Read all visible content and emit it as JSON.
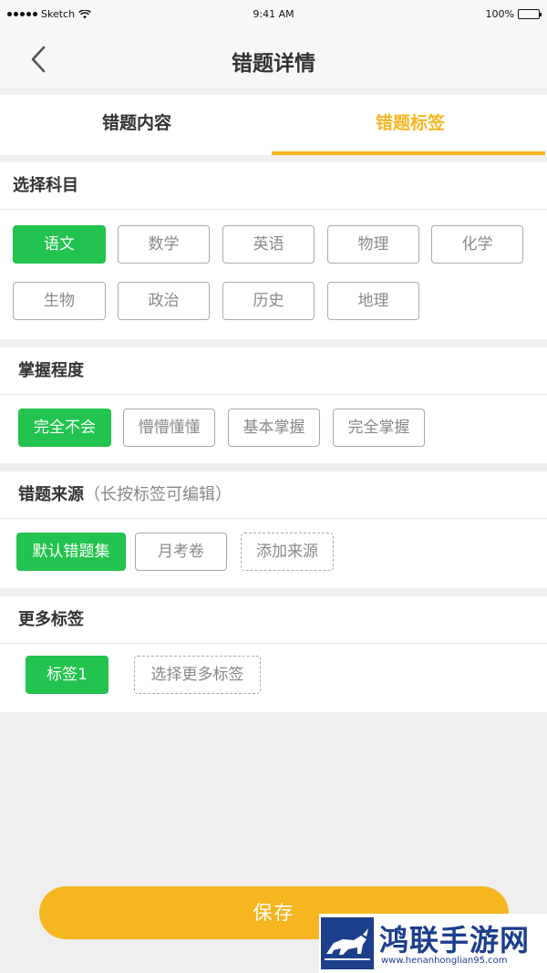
{
  "status_bar": {
    "carrier": "Sketch",
    "time": "9:41 AM",
    "battery": "100%"
  },
  "nav": {
    "title": "错题详情"
  },
  "tabs": [
    {
      "label": "错题内容",
      "active": false
    },
    {
      "label": "错题标签",
      "active": true
    }
  ],
  "subject_section": {
    "title": "选择科目",
    "options": [
      "语文",
      "数学",
      "英语",
      "物理",
      "化学",
      "生物",
      "政治",
      "历史",
      "地理"
    ],
    "selected": "语文"
  },
  "mastery_section": {
    "title": "掌握程度",
    "options": [
      "完全不会",
      "懵懵懂懂",
      "基本掌握",
      "完全掌握"
    ],
    "selected": "完全不会"
  },
  "source_section": {
    "title": "错题来源",
    "hint": "（长按标签可编辑）",
    "options": [
      "默认错题集",
      "月考卷"
    ],
    "selected": "默认错题集",
    "add_label": "添加来源"
  },
  "tags_section": {
    "title": "更多标签",
    "options": [
      "标签1"
    ],
    "selected": "标签1",
    "more_label": "选择更多标签"
  },
  "save_label": "保存",
  "watermark": {
    "name": "鸿联手游网",
    "url": "www.henanhonglian95.com"
  },
  "colors": {
    "accent": "#f5b622",
    "selected": "#22c34e",
    "text": "#333333",
    "muted": "#888888"
  }
}
